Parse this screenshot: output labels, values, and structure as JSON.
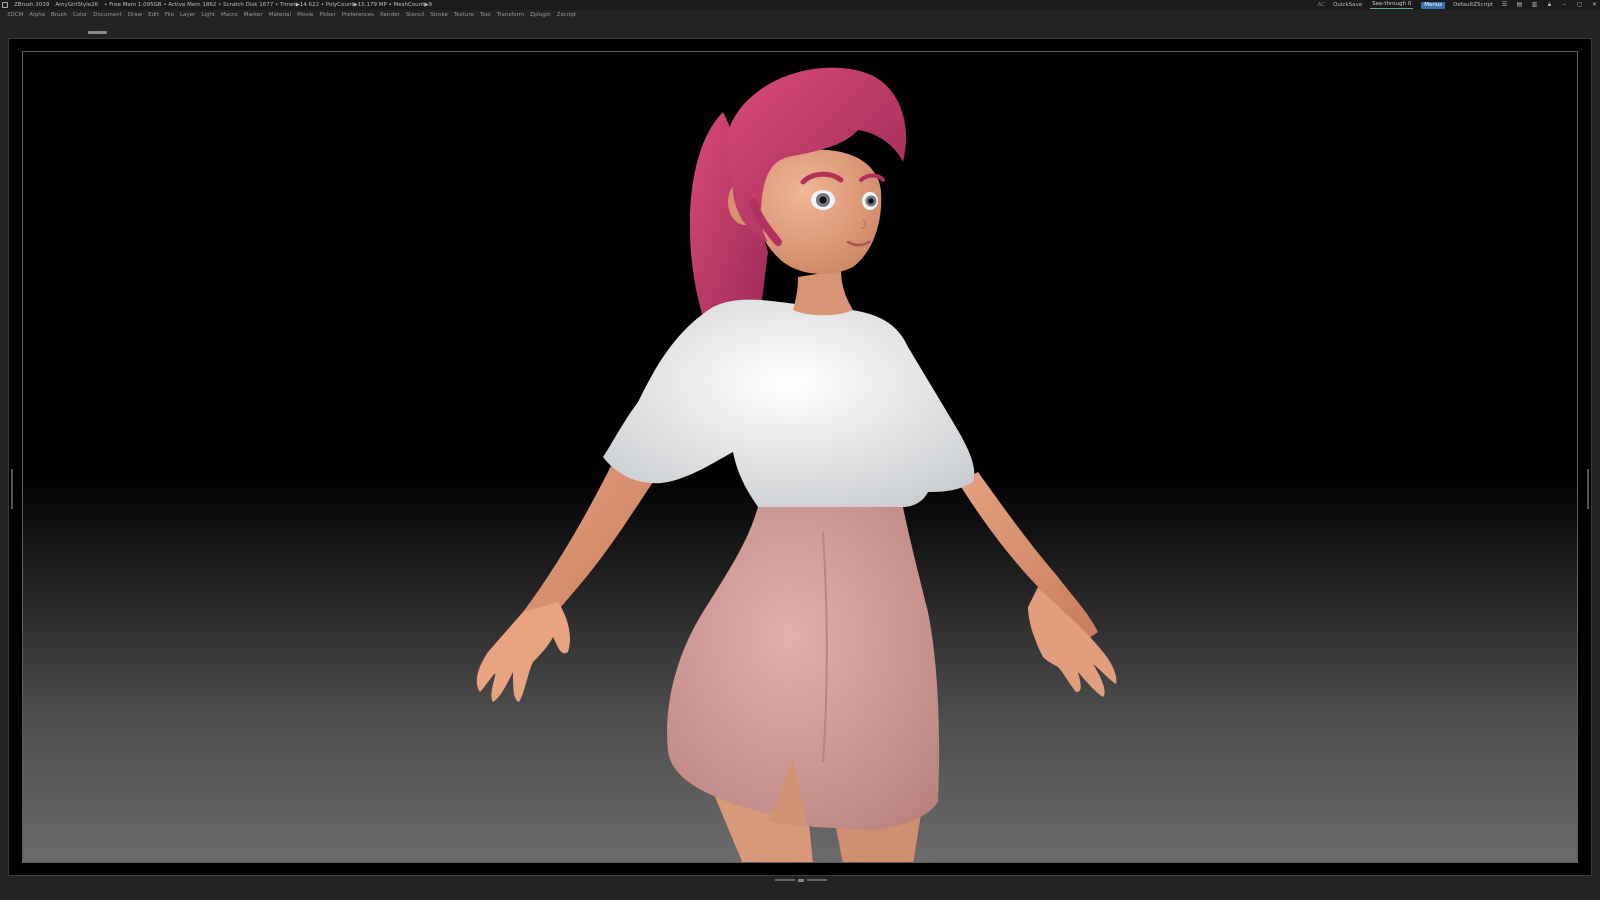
{
  "titlebar": {
    "app_name": "ZBrush 2019",
    "document_name": "AmyGirlStyle26",
    "stats": "• Free Mem 1.095GB • Active Mem 1862 • Scratch Disk 1677 • Timer▶14.622 • PolyCount▶15.179 MP • MeshCount▶9",
    "ac_label": "AC",
    "quicksave_label": "QuickSave",
    "seethrough_label": "See-through 0",
    "menus_label": "Menus",
    "script_label": "DefaultZScript"
  },
  "menubar": {
    "items": [
      "3DCM",
      "Alpha",
      "Brush",
      "Color",
      "Document",
      "Draw",
      "Edit",
      "File",
      "Layer",
      "Light",
      "Macro",
      "Marker",
      "Material",
      "Movie",
      "Picker",
      "Preferences",
      "Render",
      "Stencil",
      "Stroke",
      "Texture",
      "Tool",
      "Transform",
      "Zplugin",
      "Zscript"
    ]
  },
  "colors": {
    "skin": "#e9a585",
    "hair": "#c93d6e",
    "shirt": "#eef0f1",
    "skirt": "#d8a3a0"
  },
  "icons": {
    "app": "zbrush-app-icon",
    "window_controls": [
      "layout-icon",
      "layout-icon",
      "layout-icon",
      "lock-icon",
      "minimize-icon",
      "restore-icon",
      "close-icon"
    ]
  }
}
